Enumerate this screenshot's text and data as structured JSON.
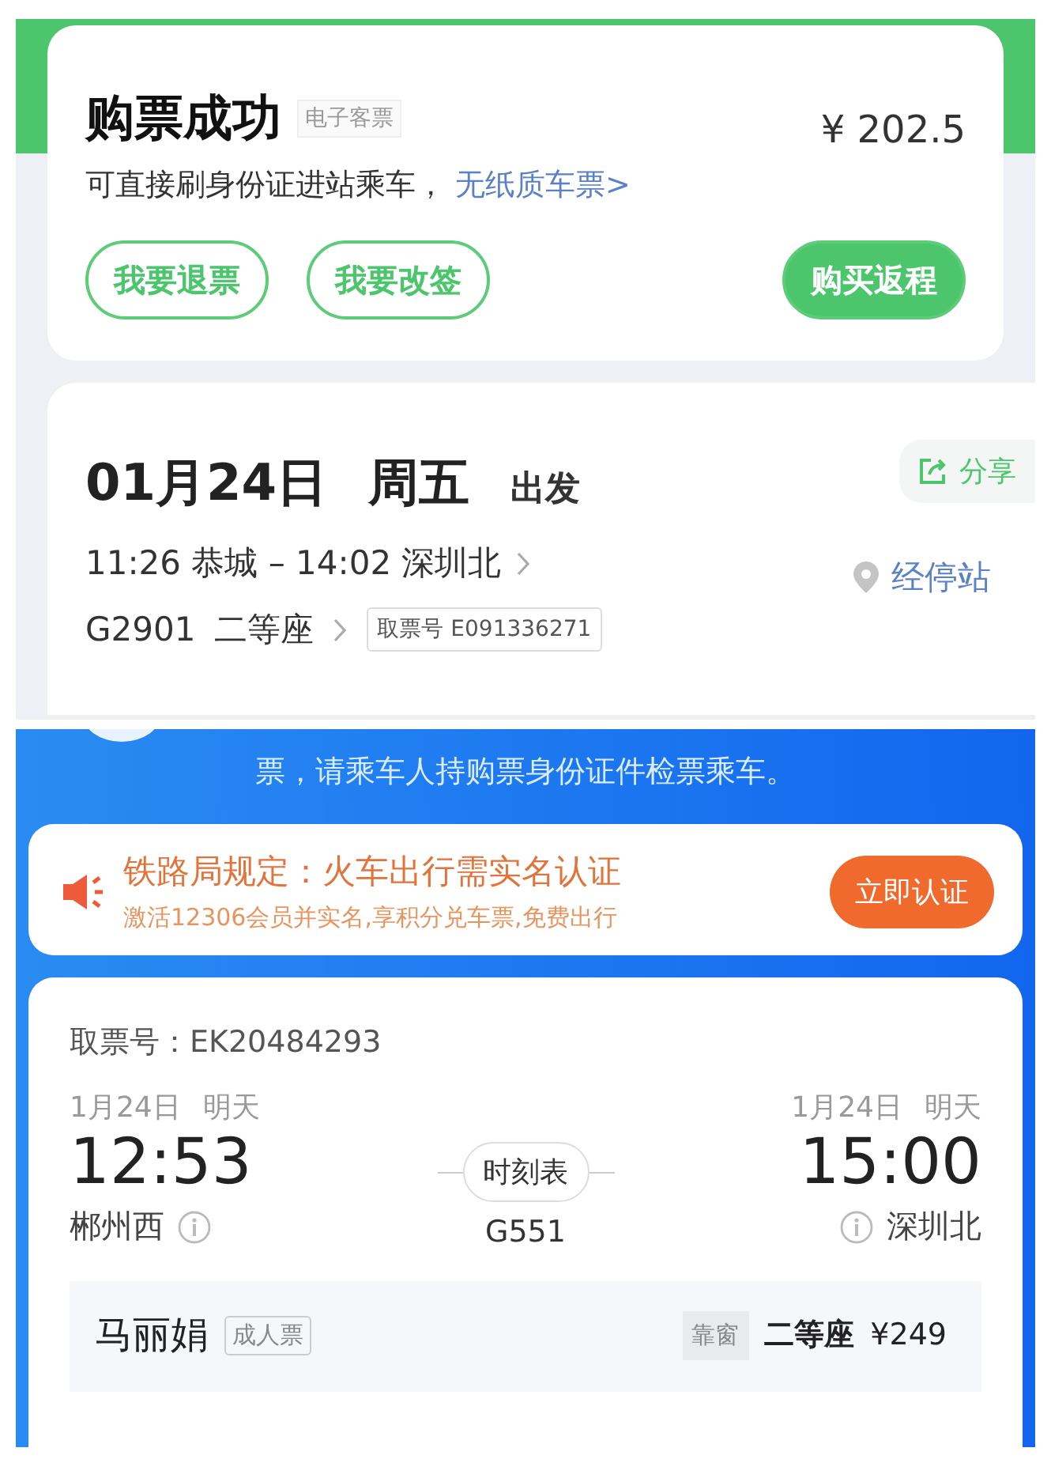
{
  "top_screen": {
    "status_card": {
      "title": "购票成功",
      "badge": "电子客票",
      "price": "¥ 202.5",
      "note": "可直接刷身份证进站乘车，",
      "link": "无纸质车票>",
      "buttons": [
        {
          "label": "我要退票",
          "kind": "outline"
        },
        {
          "label": "我要改签",
          "kind": "outline"
        },
        {
          "label": "购买返程",
          "kind": "filled"
        }
      ]
    },
    "trip_card": {
      "date": "01月24日",
      "weekday": "周五",
      "suffix": "出发",
      "route": "11:26 恭城 – 14:02 深圳北",
      "share": "分享",
      "stops": "经停站",
      "train": "G2901",
      "seat": "二等座",
      "ticket_no": "取票号 E091336271"
    }
  },
  "bottom_screen": {
    "notice": "票，请乘车人持购票身份证件检票乘车。",
    "alert": {
      "title": "铁路局规定：火车出行需实名认证",
      "subtitle": "激活12306会员并实名,享积分兑车票,免费出行",
      "button": "立即认证"
    },
    "ticket": {
      "ticket_no": "取票号：EK20484293",
      "departure": {
        "date": "1月24日",
        "day": "明天",
        "time": "12:53",
        "station": "郴州西"
      },
      "arrival": {
        "date": "1月24日",
        "day": "明天",
        "time": "15:00",
        "station": "深圳北"
      },
      "timetable": "时刻表",
      "train": "G551",
      "passenger": {
        "name": "马丽娟",
        "type": "成人票",
        "seat_pref": "靠窗",
        "seat_class": "二等座",
        "price": "¥249"
      }
    }
  }
}
